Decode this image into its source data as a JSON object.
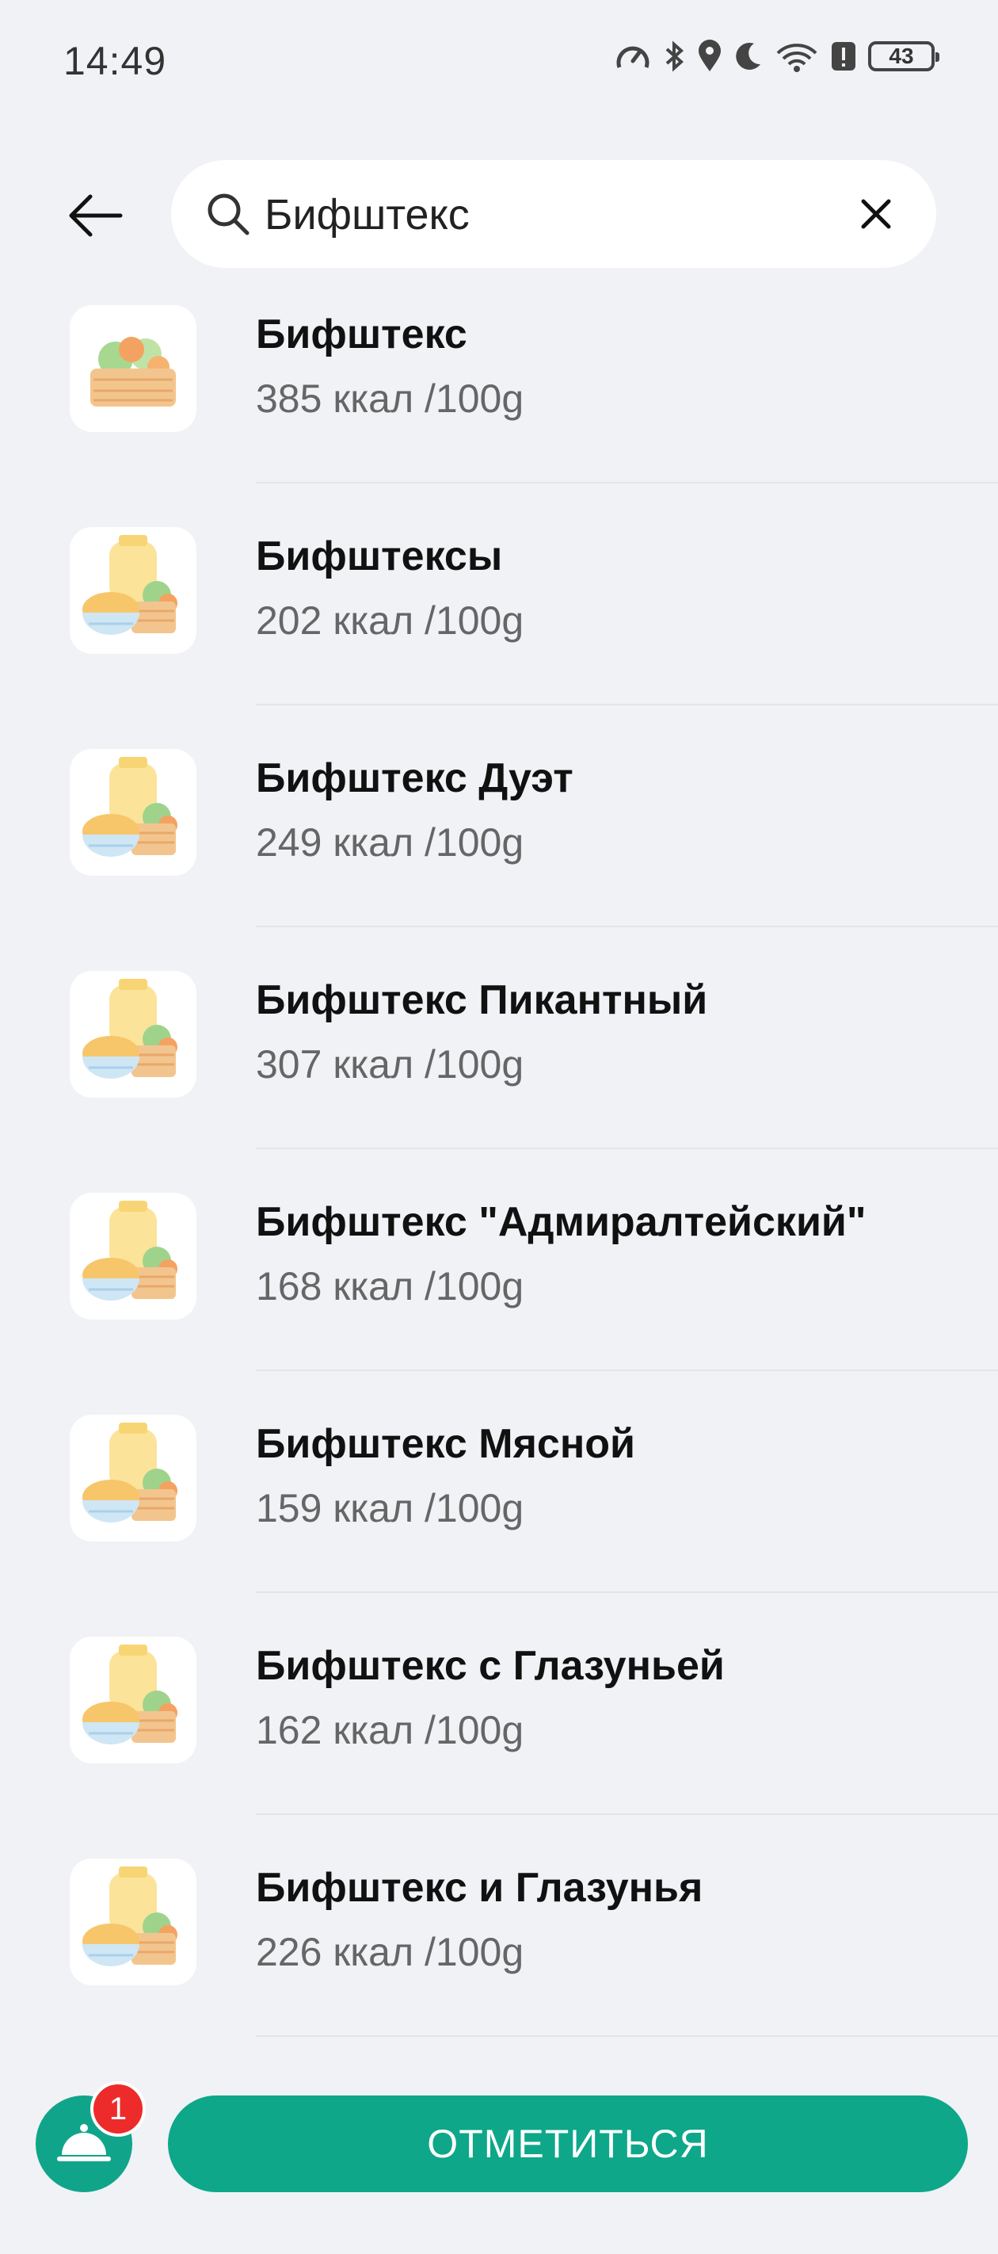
{
  "status_bar": {
    "time": "14:49",
    "battery": "43",
    "icons": [
      "data-speed-icon",
      "bluetooth-icon",
      "location-icon",
      "moon-icon",
      "wifi-icon",
      "alert-icon",
      "battery-icon"
    ]
  },
  "search": {
    "value": "Бифштекс"
  },
  "items": [
    {
      "name": "Бифштекс",
      "kcal": "385 ккал  /100g",
      "icon": "salad-basket-icon"
    },
    {
      "name": "Бифштексы",
      "kcal": "202 ккал  /100g",
      "icon": "meal-set-icon"
    },
    {
      "name": "Бифштекс Дуэт",
      "kcal": "249 ккал  /100g",
      "icon": "meal-set-icon"
    },
    {
      "name": "Бифштекс Пикантный",
      "kcal": "307 ккал  /100g",
      "icon": "meal-set-icon"
    },
    {
      "name": "Бифштекс \"Адмиралтейский\"",
      "kcal": "168 ккал  /100g",
      "icon": "meal-set-icon"
    },
    {
      "name": "Бифштекс Мясной",
      "kcal": "159 ккал  /100g",
      "icon": "meal-set-icon"
    },
    {
      "name": "Бифштекс с Глазуньей",
      "kcal": "162 ккал  /100g",
      "icon": "meal-set-icon"
    },
    {
      "name": "Бифштекс и Глазунья",
      "kcal": "226 ккал  /100g",
      "icon": "meal-set-icon"
    }
  ],
  "bottom": {
    "badge_count": "1",
    "checkin_label": "ОТМЕТИТЬСЯ"
  },
  "colors": {
    "accent": "#0ea78a",
    "badge": "#ee2b2b",
    "background": "#f0f2f5"
  }
}
